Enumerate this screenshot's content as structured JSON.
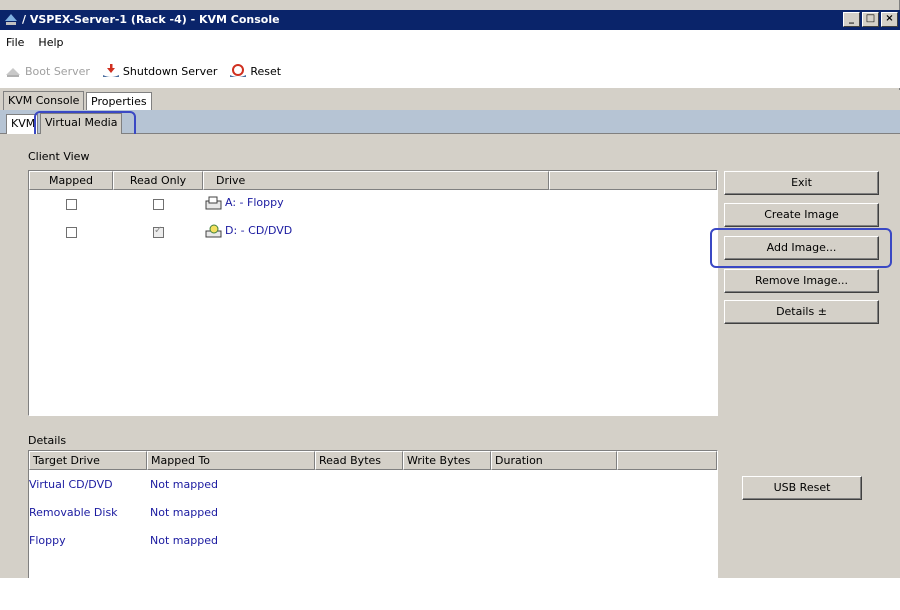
{
  "window": {
    "title": "/ VSPEX-Server-1 (Rack -4) - KVM Console",
    "controls": [
      "_",
      "□",
      "×"
    ]
  },
  "menu": [
    "File",
    "Help"
  ],
  "toolbar": {
    "boot": "Boot Server",
    "shutdown": "Shutdown Server",
    "reset": "Reset"
  },
  "tabs_outer": [
    "KVM Console",
    "Properties"
  ],
  "tabs_inner": [
    "KVM",
    "Virtual Media"
  ],
  "client_view": {
    "label": "Client View",
    "columns": [
      "Mapped",
      "Read Only",
      "Drive"
    ],
    "rows": [
      {
        "mapped": false,
        "read_only": false,
        "drive": "A: - Floppy"
      },
      {
        "mapped": false,
        "read_only": true,
        "drive": "D: - CD/DVD"
      }
    ]
  },
  "buttons": {
    "exit": "Exit",
    "create_image": "Create Image",
    "add_image": "Add Image...",
    "remove_image": "Remove Image...",
    "details": "Details ±",
    "usb_reset": "USB Reset"
  },
  "details": {
    "label": "Details",
    "columns": [
      "Target Drive",
      "Mapped To",
      "Read Bytes",
      "Write Bytes",
      "Duration"
    ],
    "rows": [
      {
        "target": "Virtual CD/DVD",
        "mapped_to": "Not mapped"
      },
      {
        "target": "Removable Disk",
        "mapped_to": "Not mapped"
      },
      {
        "target": "Floppy",
        "mapped_to": "Not mapped"
      }
    ]
  },
  "colors": {
    "titlebar": "#0a246a",
    "link_text": "#1a1aa0",
    "highlight": "#3a48c4"
  }
}
